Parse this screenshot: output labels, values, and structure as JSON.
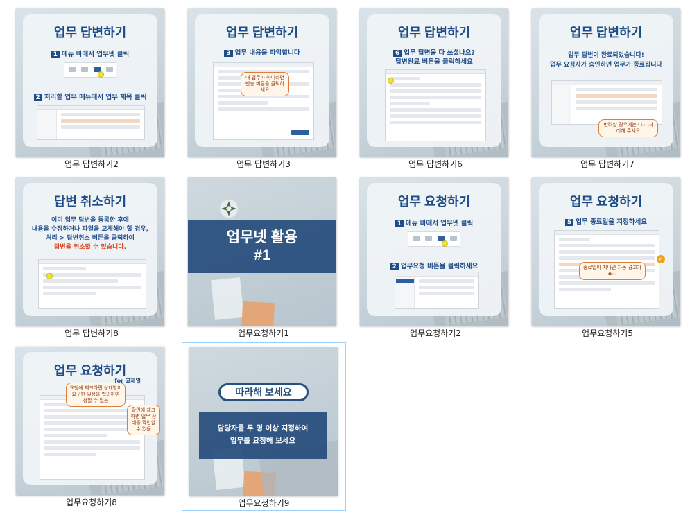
{
  "files": [
    {
      "name": "업무 답변하기2"
    },
    {
      "name": "업무 답변하기3"
    },
    {
      "name": "업무 답변하기6"
    },
    {
      "name": "업무 답변하기7"
    },
    {
      "name": "업무 답변하기8"
    },
    {
      "name": "업무요청하기1"
    },
    {
      "name": "업무요청하기2"
    },
    {
      "name": "업무요청하기5"
    },
    {
      "name": "업무요청하기8"
    },
    {
      "name": "업무요청하기9"
    }
  ],
  "thumbs": {
    "t0": {
      "title": "업무 답변하기",
      "step1_num": "1",
      "step1": "메뉴 바에서 업무넷 클릭",
      "step2_num": "2",
      "step2": "처리할 업무 메뉴에서 업무 제목 클릭"
    },
    "t1": {
      "title": "업무 답변하기",
      "step_num": "3",
      "step": "업무 내용을 파악합니다",
      "callout": "내 업무가 아니라면 반송 버튼을 클릭하세요"
    },
    "t2": {
      "title": "업무 답변하기",
      "step_num": "6",
      "step_a": "업무 답변을 다 쓰셨나요?",
      "step_b": "답변완료 버튼을 클릭하세요"
    },
    "t3": {
      "title": "업무 답변하기",
      "line1": "업무 답변이 완료되었습니다!",
      "line2": "업무 요청자가 승인하면 업무가 종료됩니다",
      "callout": "반려할 경우에는 다시 처리해 주세요"
    },
    "t4": {
      "title": "답변 취소하기",
      "line1": "이미 업무 답변을 등록한 후에",
      "line2": "내용을 수정하거나 파일을 교체해야 할 경우,",
      "line3": "처리 > 답변취소 버튼을 클릭하여",
      "line4": "답변을 취소할 수 있습니다."
    },
    "t5": {
      "line1": "업무넷 활용",
      "line2": "#1"
    },
    "t6": {
      "title": "업무 요청하기",
      "step1_num": "1",
      "step1": "메뉴 바에서 업무넷 클릭",
      "step2_num": "2",
      "step2": "업무요청 버튼을 클릭하세요"
    },
    "t7": {
      "title": "업무 요청하기",
      "step_num": "5",
      "step": "업무 종료일을 지정하세요",
      "callout": "종료일이 지나면 자동 경고가 표시"
    },
    "t8": {
      "title": "업무 요청하기",
      "subtitle": "for 교체열",
      "callout1": "요청에 체크하면 상대방이 요구한 일정을 협의하여 정할 수 있음",
      "callout2": "확인에 체크하면 업무 상태를 확인할 수 있음"
    },
    "t9": {
      "pill": "따라해 보세요",
      "line1": "담당자를 두 명 이상 지정하여",
      "line2": "업무를 요청해 보세요"
    }
  },
  "colors": {
    "accent": "#1f4b86",
    "highlight": "#e07b39",
    "selection": "#99d1ff"
  }
}
